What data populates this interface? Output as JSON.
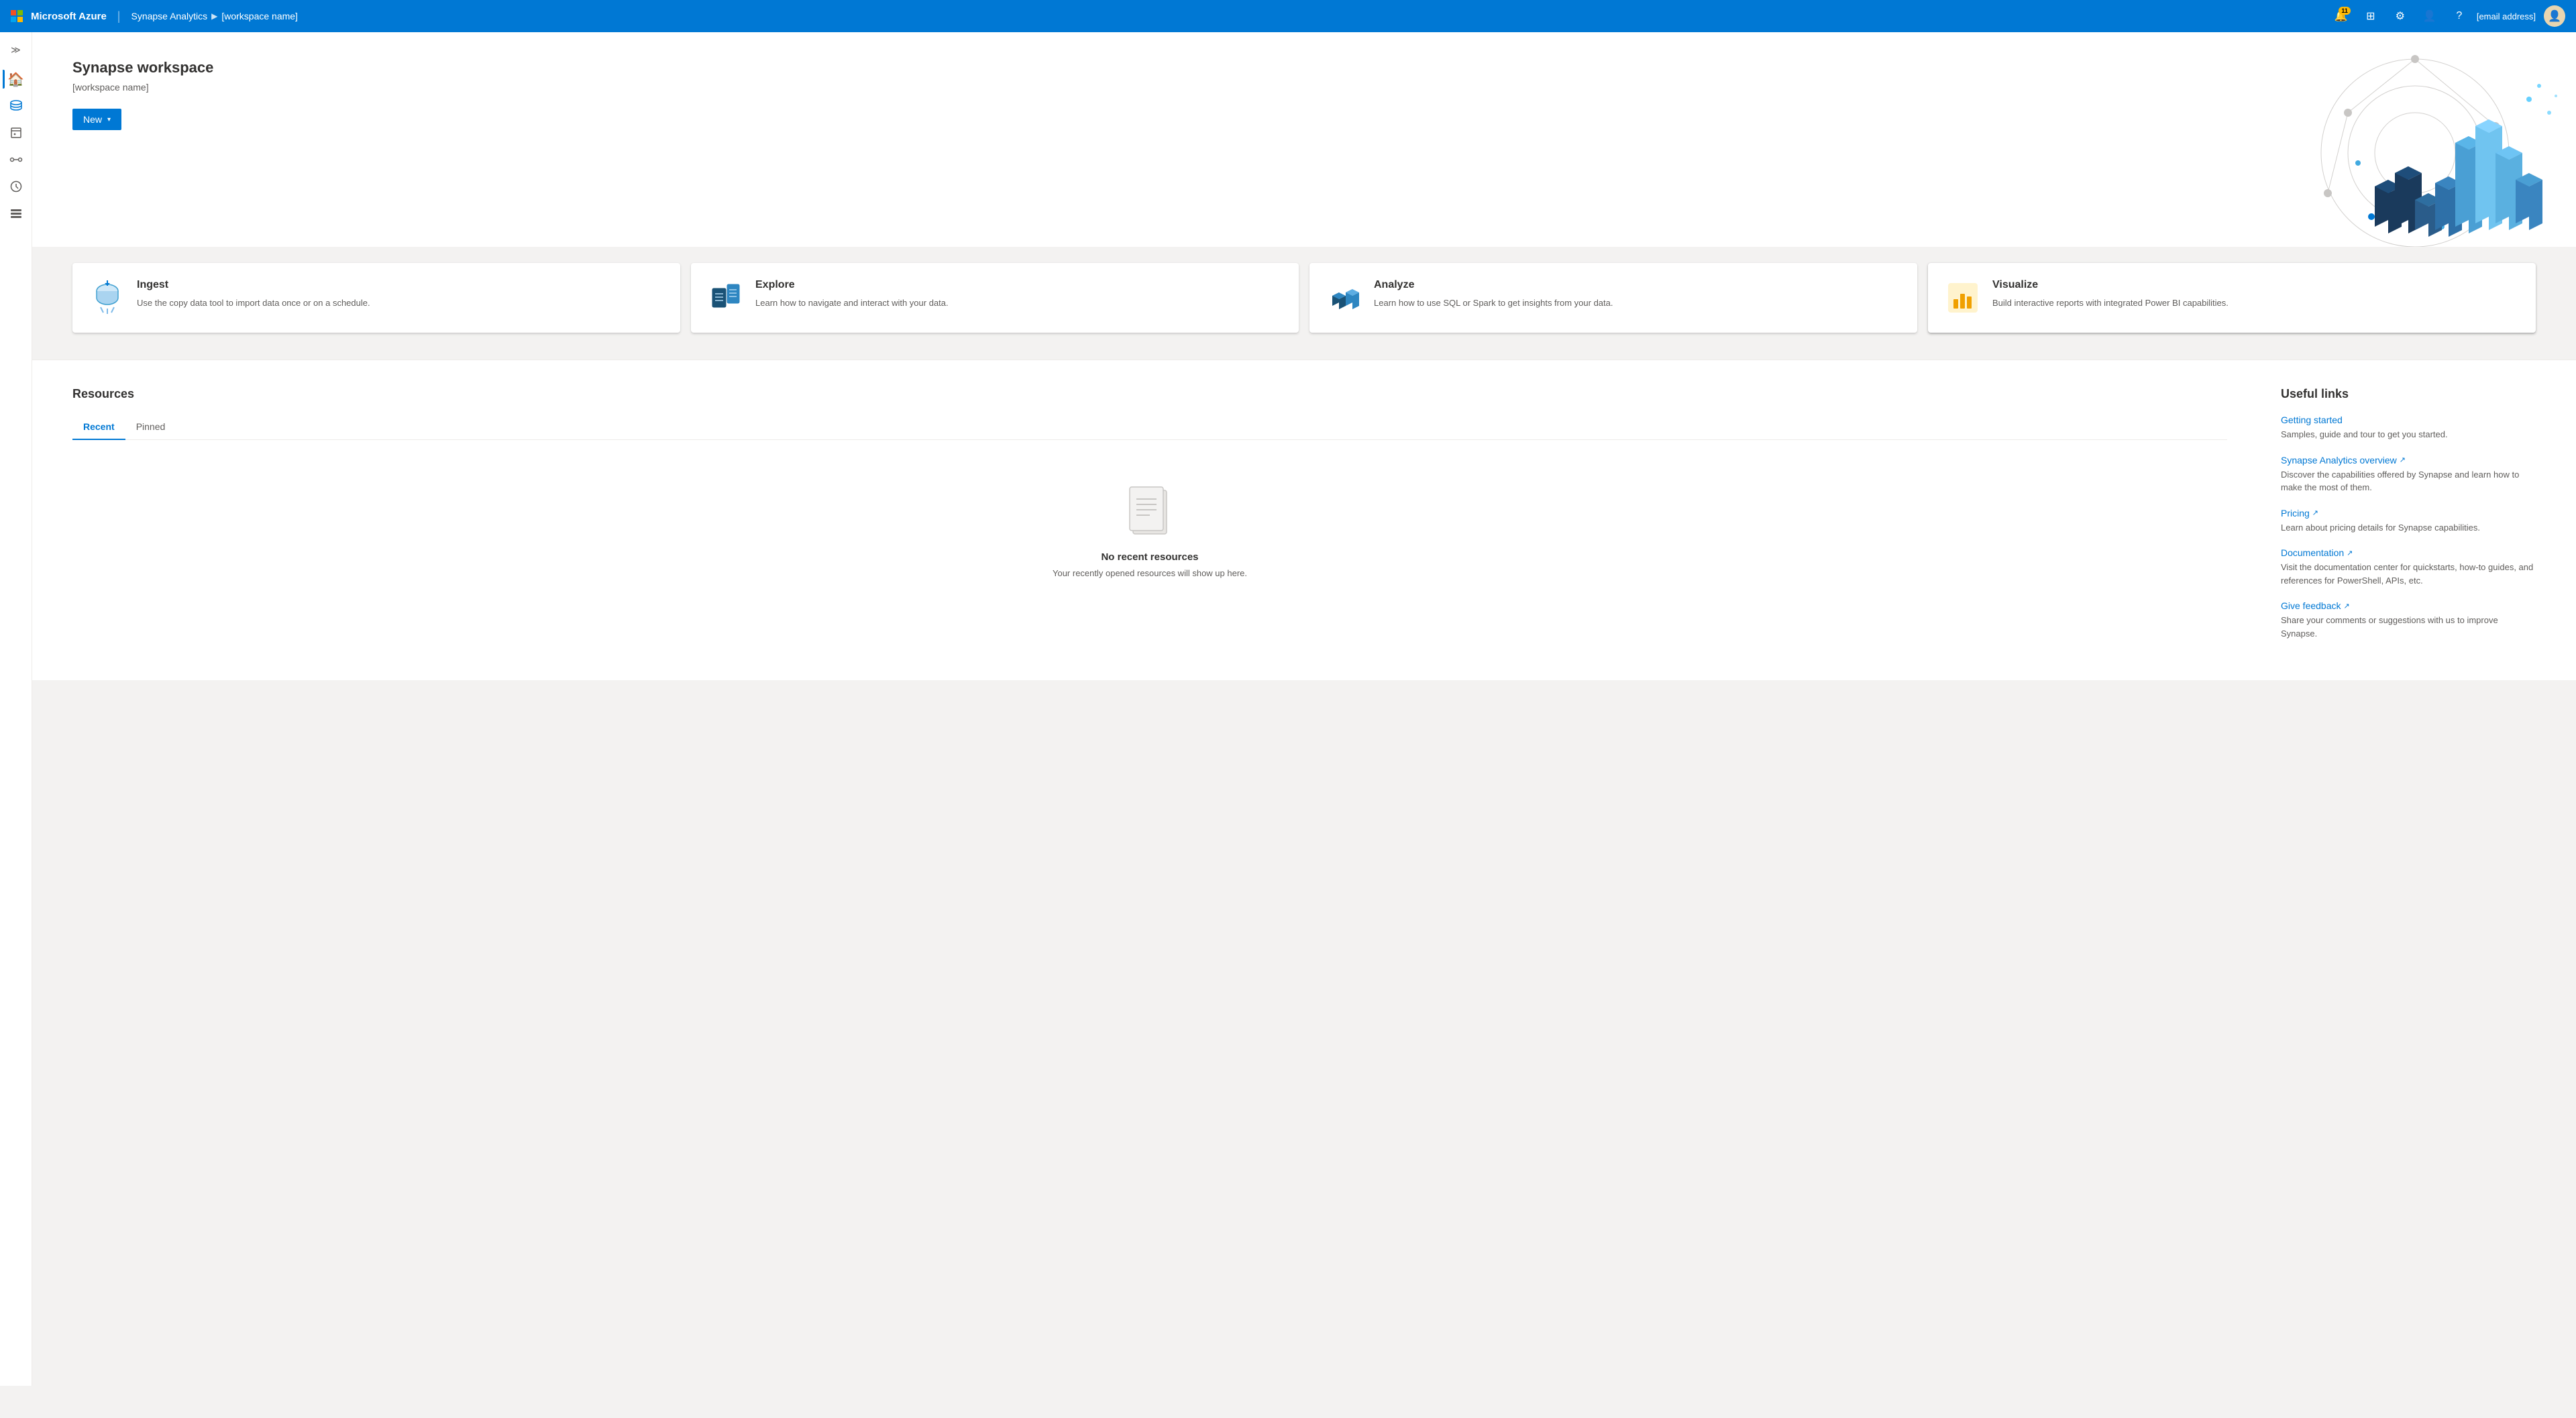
{
  "topnav": {
    "brand": "Microsoft Azure",
    "separator": "|",
    "breadcrumb_app": "Synapse Analytics",
    "breadcrumb_arrow": "▶",
    "breadcrumb_workspace": "[workspace name]",
    "notification_count": "11",
    "email": "[email address]",
    "icons": {
      "notification": "🔔",
      "portal": "⊞",
      "settings": "⚙",
      "help": "?"
    }
  },
  "sidebar": {
    "toggle": "≫",
    "items": [
      {
        "id": "home",
        "icon": "🏠",
        "label": "Home",
        "active": true
      },
      {
        "id": "data",
        "icon": "🗄",
        "label": "Data",
        "active": false
      },
      {
        "id": "develop",
        "icon": "📋",
        "label": "Develop",
        "active": false
      },
      {
        "id": "integrate",
        "icon": "🔄",
        "label": "Integrate",
        "active": false
      },
      {
        "id": "monitor",
        "icon": "⏱",
        "label": "Monitor",
        "active": false
      },
      {
        "id": "manage",
        "icon": "🧰",
        "label": "Manage",
        "active": false
      }
    ]
  },
  "hero": {
    "workspace_title": "Synapse workspace",
    "workspace_name": "[workspace name]",
    "new_button": "New",
    "new_chevron": "▾"
  },
  "cards": [
    {
      "id": "ingest",
      "title": "Ingest",
      "description": "Use the copy data tool to import data once or on a schedule."
    },
    {
      "id": "explore",
      "title": "Explore",
      "description": "Learn how to navigate and interact with your data."
    },
    {
      "id": "analyze",
      "title": "Analyze",
      "description": "Learn how to use SQL or Spark to get insights from your data."
    },
    {
      "id": "visualize",
      "title": "Visualize",
      "description": "Build interactive reports with integrated Power BI capabilities."
    }
  ],
  "resources": {
    "title": "Resources",
    "tabs": [
      {
        "id": "recent",
        "label": "Recent",
        "active": true
      },
      {
        "id": "pinned",
        "label": "Pinned",
        "active": false
      }
    ],
    "empty_title": "No recent resources",
    "empty_desc": "Your recently opened resources will show up here."
  },
  "useful_links": {
    "title": "Useful links",
    "links": [
      {
        "id": "getting-started",
        "title": "Getting started",
        "external": false,
        "description": "Samples, guide and tour to get you started."
      },
      {
        "id": "overview",
        "title": "Synapse Analytics overview",
        "external": true,
        "description": "Discover the capabilities offered by Synapse and learn how to make the most of them."
      },
      {
        "id": "pricing",
        "title": "Pricing",
        "external": true,
        "description": "Learn about pricing details for Synapse capabilities."
      },
      {
        "id": "documentation",
        "title": "Documentation",
        "external": true,
        "description": "Visit the documentation center for quickstarts, how-to guides, and references for PowerShell, APIs, etc."
      },
      {
        "id": "feedback",
        "title": "Give feedback",
        "external": true,
        "description": "Share your comments or suggestions with us to improve Synapse."
      }
    ]
  }
}
